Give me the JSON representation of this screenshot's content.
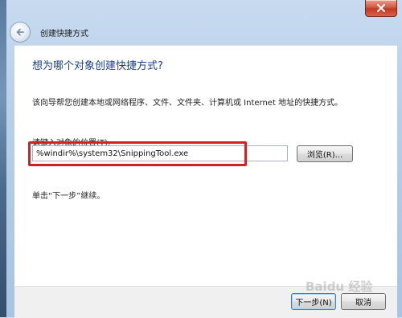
{
  "window": {
    "title": "创建快捷方式"
  },
  "wizard": {
    "heading": "想为哪个对象创建快捷方式?",
    "description": "该向导帮您创建本地或网络程序、文件、文件夹、计算机或 Internet 地址的快捷方式。",
    "location_label": "请键入对象的位置(T):",
    "location_value": "%windir%\\system32\\SnippingTool.exe",
    "browse_label": "浏览(R)...",
    "continue_text": "单击“下一步”继续。"
  },
  "footer": {
    "next_label": "下一步(N)",
    "cancel_label": "取消"
  },
  "watermark": {
    "text": "Baidu 经验"
  },
  "colors": {
    "heading": "#1a3f8a",
    "highlight": "#d42020"
  },
  "icons": {
    "close": "close-icon",
    "back": "back-arrow-icon"
  }
}
